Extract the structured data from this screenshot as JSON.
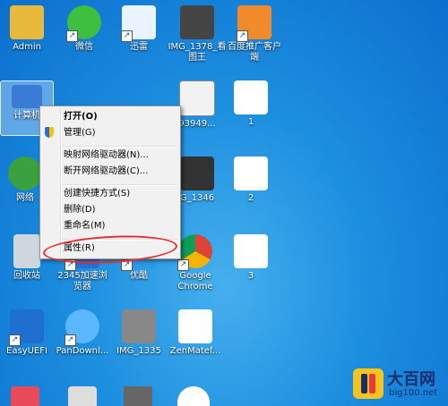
{
  "desktop_icons": [
    {
      "label": "Admin",
      "color": "#e8b93a"
    },
    {
      "label": "微信",
      "color": "#3fbf3f"
    },
    {
      "label": "迅雷",
      "color": "#2e8ae6"
    },
    {
      "label": "IMG_1378_看图王",
      "color": "#444444"
    },
    {
      "label": "百度推广客户端",
      "color": "#f08a2a"
    },
    {
      "label": "计算机",
      "color": "#3a7bd5"
    },
    {
      "label": "93949...",
      "color": "#555555"
    },
    {
      "label": "1",
      "color": "#ffffff"
    },
    {
      "label": "网络",
      "color": "#3aa040"
    },
    {
      "label": "G_1346",
      "color": "#333333"
    },
    {
      "label": "2",
      "color": "#ffffff"
    },
    {
      "label": "回收站",
      "color": "#cfd6de"
    },
    {
      "label": "2345加速浏览器",
      "color": "#2a6fd0"
    },
    {
      "label": "优酷",
      "color": "#2a9ae6"
    },
    {
      "label": "Google Chrome",
      "color": "#db4437"
    },
    {
      "label": "3",
      "color": "#ffffff"
    },
    {
      "label": "EasyUEFI",
      "color": "#1f6fd0"
    },
    {
      "label": "PanDownl...",
      "color": "#5bb7ff"
    },
    {
      "label": "IMG_1335",
      "color": "#888888"
    },
    {
      "label": "ZenMatef...",
      "color": "#ffffff"
    }
  ],
  "context_menu": {
    "open": "打开(O)",
    "manage": "管理(G)",
    "map_drive": "映射网络驱动器(N)...",
    "disconnect_drive": "断开网络驱动器(C)...",
    "create_shortcut": "创建快捷方式(S)",
    "delete": "删除(D)",
    "rename": "重命名(M)",
    "properties": "属性(R)"
  },
  "watermark": {
    "title": "大百网",
    "url": "big100.net"
  }
}
